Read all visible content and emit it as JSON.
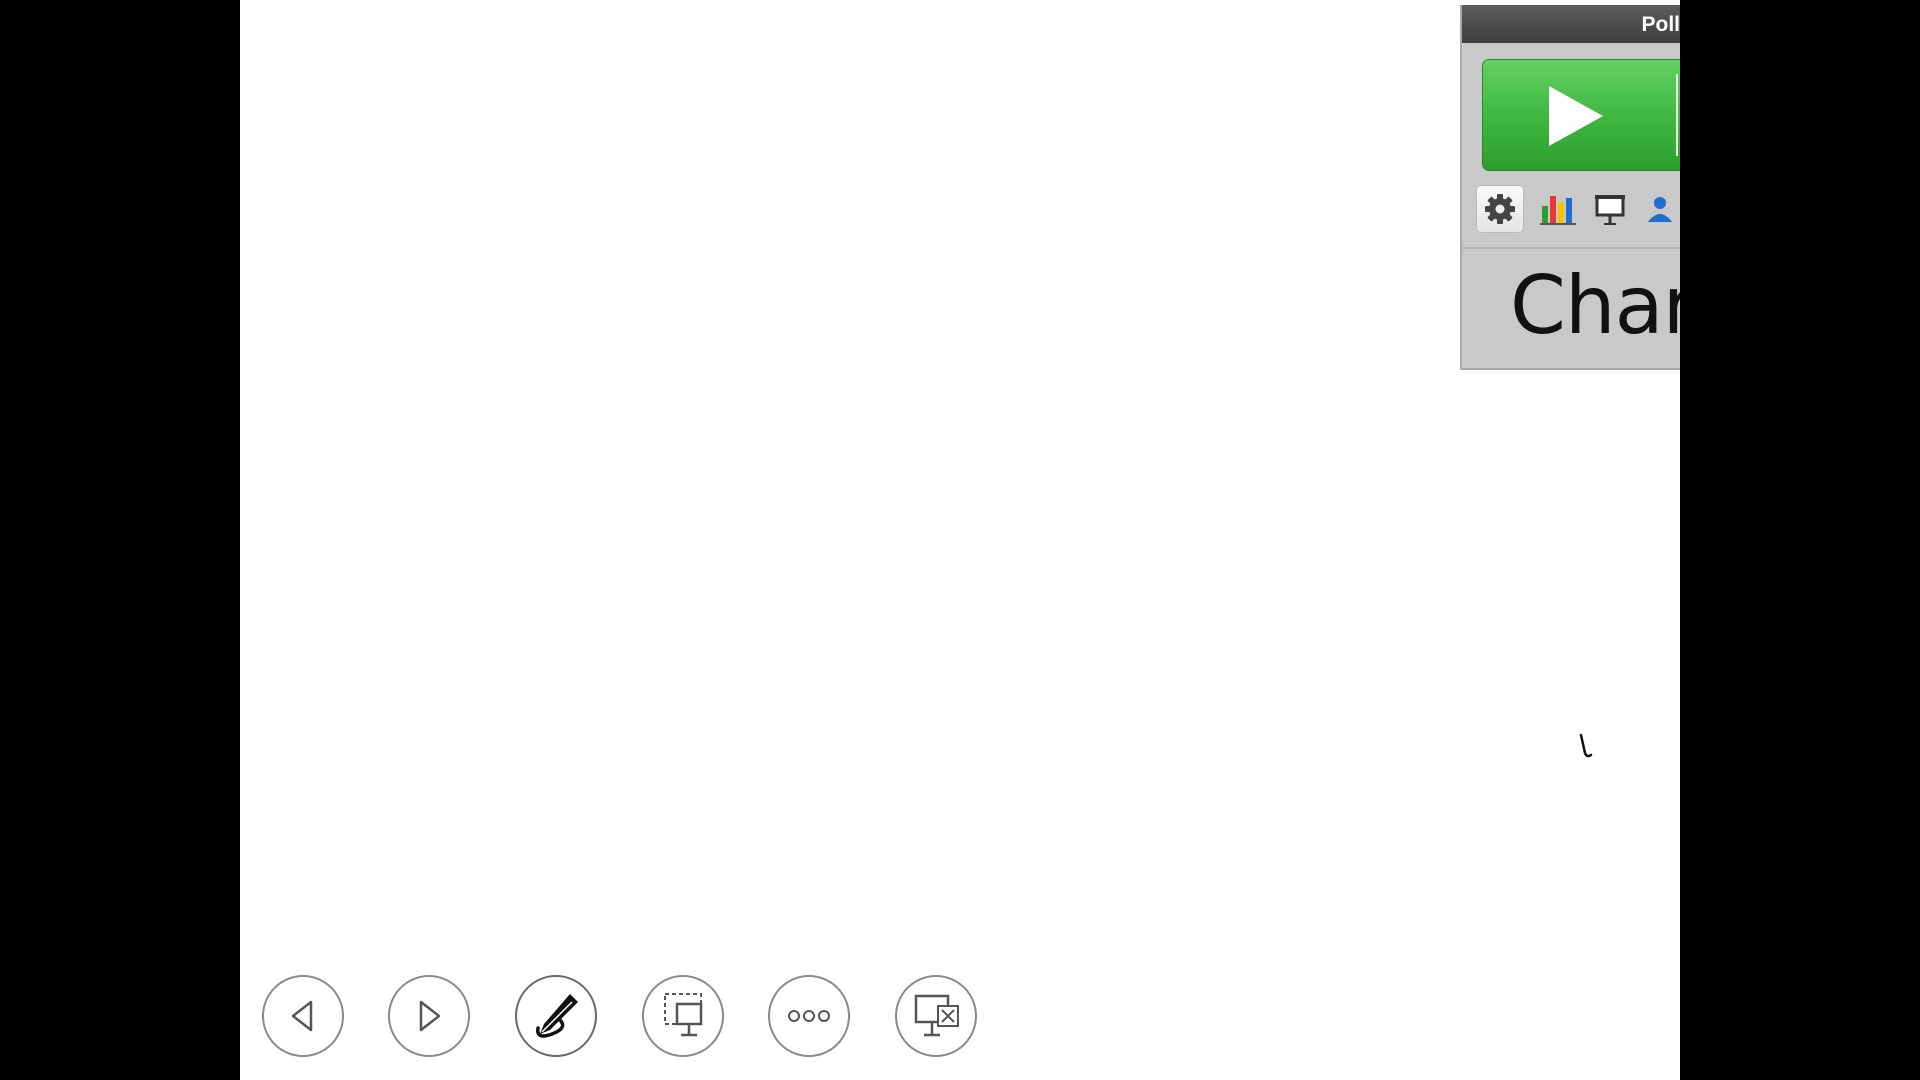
{
  "poll_widget": {
    "title": "Poll",
    "heading": "Char",
    "start_button_icon": "play-icon",
    "toolbar_icons": [
      "gear-icon",
      "bar-chart-icon",
      "presentation-screen-icon",
      "user-icon"
    ],
    "colors": {
      "start_green": "#3fb53f",
      "titlebar": "#4a4a4a",
      "panel": "#c9c9c9"
    }
  },
  "slideshow_toolbar": {
    "buttons": [
      "previous-slide",
      "next-slide",
      "pen-tool",
      "zoom-slide",
      "more-options",
      "end-show"
    ]
  }
}
